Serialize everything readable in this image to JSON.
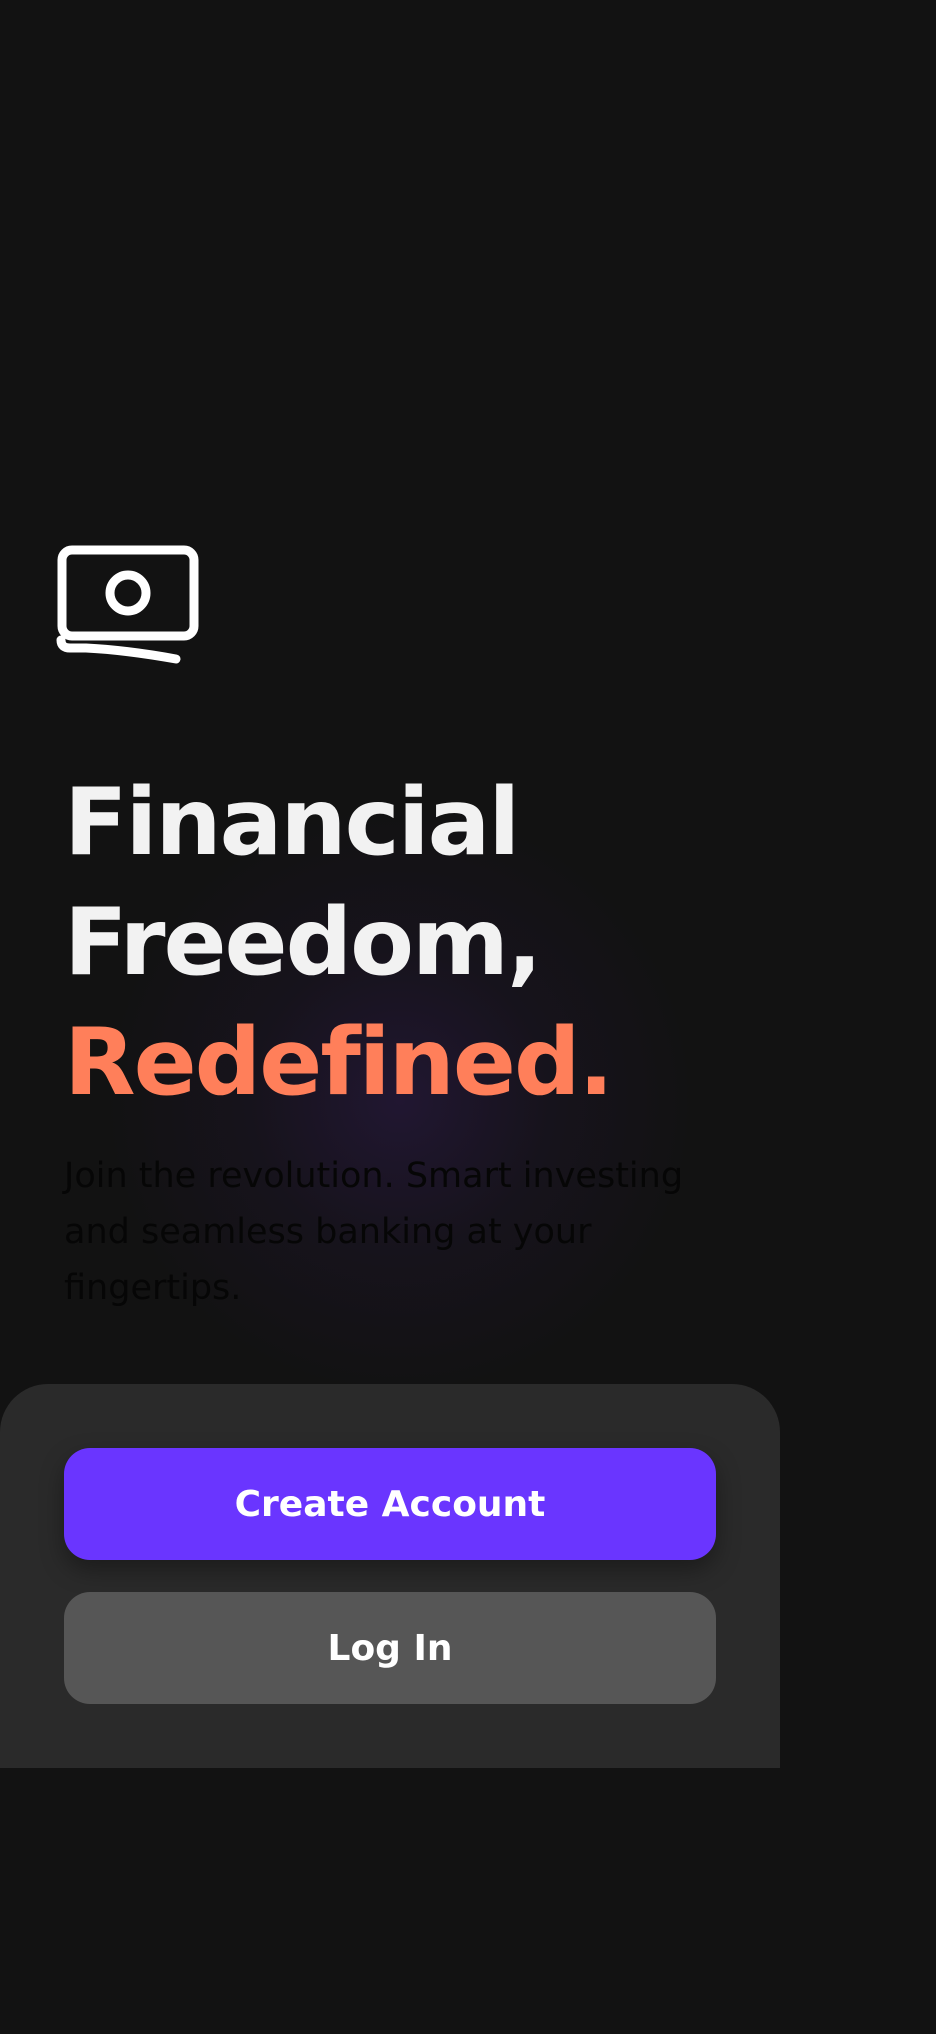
{
  "hero": {
    "logo_icon": "cash-banknote-icon",
    "headline_line1": "Financial",
    "headline_line2": "Freedom,",
    "headline_accent": "Redefined.",
    "accent_color": "#ff7f5a",
    "subtitle": "Join the revolution. Smart investing and seamless banking at your fingertips."
  },
  "actions": {
    "create_account_label": "Create Account",
    "login_label": "Log In",
    "primary_color": "#6a35ff",
    "secondary_color": "#565656"
  }
}
